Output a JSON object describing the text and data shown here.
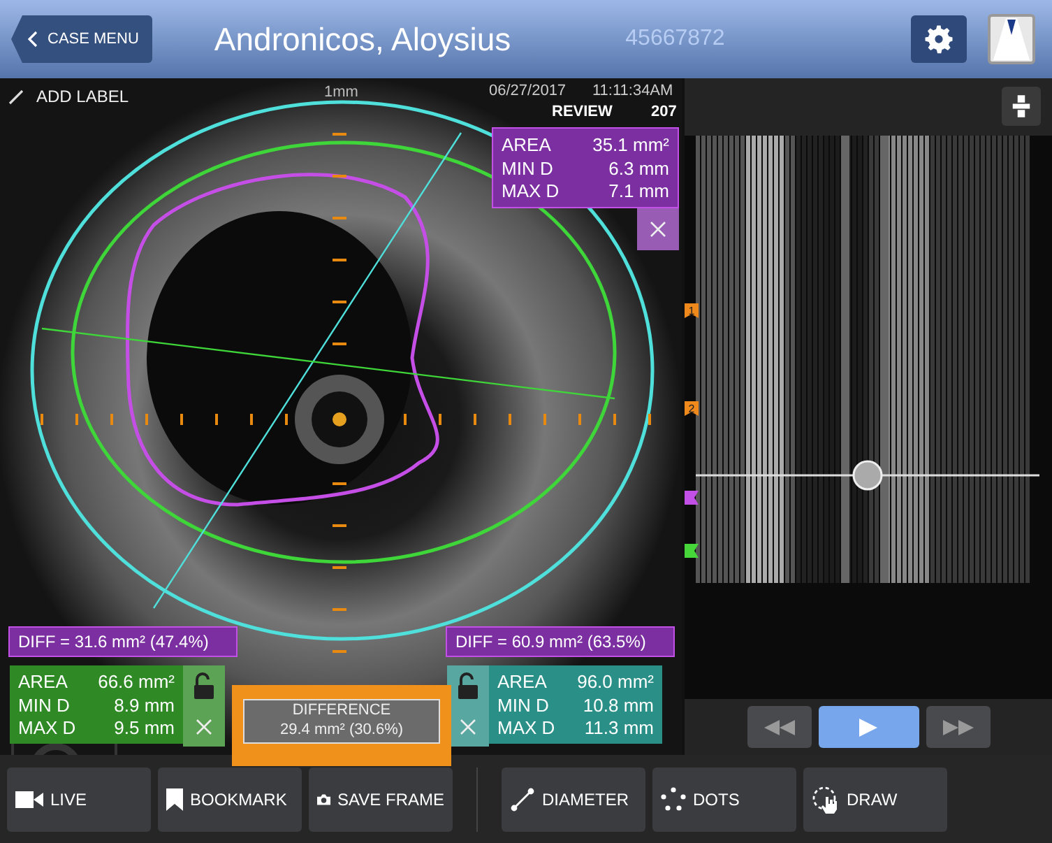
{
  "header": {
    "back_button": "CASE MENU",
    "patient_name": "Andronicos, Aloysius",
    "patient_id": "45667872"
  },
  "image_panel": {
    "add_label": "ADD LABEL",
    "scale": "1mm",
    "date": "06/27/2017",
    "time": "11:11:34AM",
    "mode": "REVIEW",
    "frame": "207",
    "measurements": [
      {
        "kind": "top",
        "color": "#7b2fa0",
        "show_lock": false,
        "rows": [
          {
            "label": "AREA",
            "value": "35.1 mm²"
          },
          {
            "label": "MIN D",
            "value": "6.3 mm"
          },
          {
            "label": "MAX D",
            "value": "7.1 mm"
          }
        ]
      },
      {
        "kind": "left",
        "color": "#2f8a26",
        "show_lock": true,
        "rows": [
          {
            "label": "AREA",
            "value": "66.6 mm²"
          },
          {
            "label": "MIN D",
            "value": "8.9 mm"
          },
          {
            "label": "MAX D",
            "value": "9.5 mm"
          }
        ]
      },
      {
        "kind": "right",
        "color": "#2a8f86",
        "show_lock": true,
        "rows": [
          {
            "label": "AREA",
            "value": "96.0 mm²"
          },
          {
            "label": "MIN D",
            "value": "10.8 mm"
          },
          {
            "label": "MAX D",
            "value": "11.3 mm"
          }
        ]
      }
    ],
    "diffs": [
      {
        "text": "DIFF = 31.6 mm² (47.4%)"
      },
      {
        "text": "DIFF = 60.9 mm² (63.5%)"
      }
    ],
    "difference": {
      "title": "DIFFERENCE",
      "value": "29.4 mm² (30.6%)"
    }
  },
  "longitudinal": {
    "markers": [
      {
        "kind": "bookmark",
        "label": "1",
        "color": "#f0891c"
      },
      {
        "kind": "bookmark",
        "label": "2",
        "color": "#f0891c"
      },
      {
        "kind": "flag",
        "color": "#c24fe6"
      },
      {
        "kind": "flag",
        "color": "#46d63a"
      }
    ],
    "playback": [
      {
        "kind": "rewind",
        "selected": false
      },
      {
        "kind": "play",
        "selected": true
      },
      {
        "kind": "forward",
        "selected": false
      }
    ]
  },
  "toolbar": [
    {
      "kind": "live",
      "label": "LIVE"
    },
    {
      "kind": "bookmark",
      "label": "BOOKMARK"
    },
    {
      "kind": "camera",
      "label": "SAVE FRAME"
    },
    {
      "kind": "diameter",
      "label": "DIAMETER"
    },
    {
      "kind": "dots",
      "label": "DOTS"
    },
    {
      "kind": "draw",
      "label": "DRAW"
    }
  ]
}
